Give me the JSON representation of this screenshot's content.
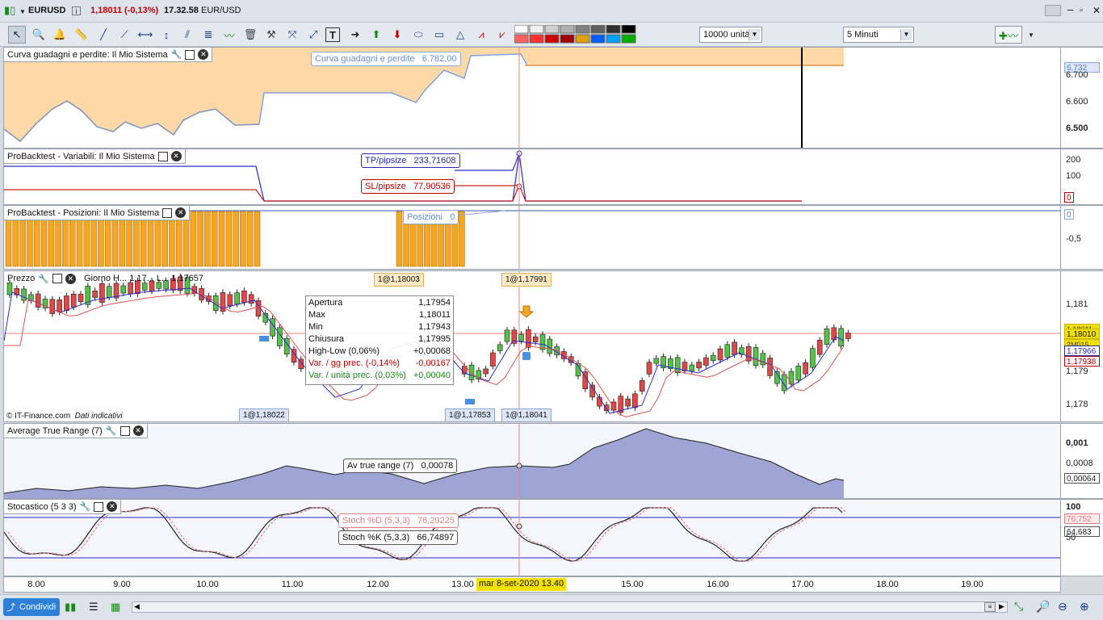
{
  "titlebar": {
    "symbol": "EURUSD",
    "price": "1,18011",
    "change": "(-0,13%)",
    "time": "17.32.58",
    "pair": "EUR/USD"
  },
  "toolbar": {
    "quantity": "10000 unità",
    "timeframe": "5 Minuti"
  },
  "panels": {
    "equity": {
      "title": "Curva guadagni e perdite: Il Mio Sistema",
      "tooltip_label": "Curva guadagni e perdite",
      "tooltip_value": "6.782,00",
      "scale": [
        "6.700",
        "6.600",
        "6.500"
      ],
      "scale_highlight": "6.732"
    },
    "variables": {
      "title": "ProBacktest - Variabili: Il Mio Sistema",
      "tp_label": "TP/pipsize",
      "tp_value": "233,71608",
      "sl_label": "SL/pipsize",
      "sl_value": "77,90536",
      "scale": [
        "200",
        "100"
      ],
      "scale_highlight": "0"
    },
    "positions": {
      "title": "ProBacktest - Posizioni: Il Mio Sistema",
      "tooltip_label": "Posizioni",
      "tooltip_value": "0",
      "scale": [
        "-0,5"
      ],
      "scale_highlight": "0"
    },
    "price": {
      "title": "Prezzo",
      "subtitle": "Giorno H... 1,17... L... 1,17657",
      "trade_tags": [
        "1@1,18003",
        "1@1,17991",
        "1@1,18022",
        "1@1,17853",
        "1@1,18041"
      ],
      "footer": "© IT-Finance.com",
      "footer_note": "Dati indicativi",
      "scale": [
        "1,181",
        "1,179",
        "1,178"
      ],
      "tag_current": "1,18010",
      "tag_blue": "1,17966",
      "tag_red": "1,17938",
      "tag_misc": "1,18011",
      "tag_small": "2M015",
      "ohlc": [
        {
          "label": "Apertura",
          "value": "1,17954",
          "color": "#111111"
        },
        {
          "label": "Max",
          "value": "1,18011",
          "color": "#111111"
        },
        {
          "label": "Min",
          "value": "1,17943",
          "color": "#111111"
        },
        {
          "label": "Chiusura",
          "value": "1,17995",
          "color": "#111111"
        },
        {
          "label": "High-Low (0,06%)",
          "value": "+0,00068",
          "color": "#111111"
        },
        {
          "label": "Var. / gg prec. (-0,14%)",
          "value": "-0,00167",
          "color": "#c00000"
        },
        {
          "label": "Var. / unità prec. (0,03%)",
          "value": "+0,00040",
          "color": "#1a8a1a"
        }
      ]
    },
    "atr": {
      "title": "Average True Range (7)",
      "tooltip_label": "Av true range (7)",
      "tooltip_value": "0,00078",
      "scale": [
        "0,001",
        "0,0008"
      ],
      "scale_highlight": "0,00064"
    },
    "stoch": {
      "title": "Stocastico (5 3 3)",
      "d_label": "Stoch %D (5,3,3)",
      "d_value": "76,29225",
      "k_label": "Stoch %K (5,3,3)",
      "k_value": "66,74897",
      "scale": [
        "100",
        "50"
      ],
      "scale_d": "76,752",
      "scale_k": "64,683"
    }
  },
  "timeaxis": {
    "ticks": [
      "8.00",
      "9.00",
      "10.00",
      "11.00",
      "12.00",
      "13.00",
      "15.00",
      "16.00",
      "17.00",
      "18.00",
      "19.00"
    ],
    "cursor_label": "mar 8-set-2020 13.40"
  },
  "bottombar": {
    "share_label": "Condividi"
  },
  "colors": {
    "equity_fill": "#fdd9a8",
    "equity_line": "#6a96e0",
    "atr_fill": "#9ea4d4",
    "bullish": "#55c04a",
    "bearish": "#e04848",
    "bars": "#f5a623"
  }
}
